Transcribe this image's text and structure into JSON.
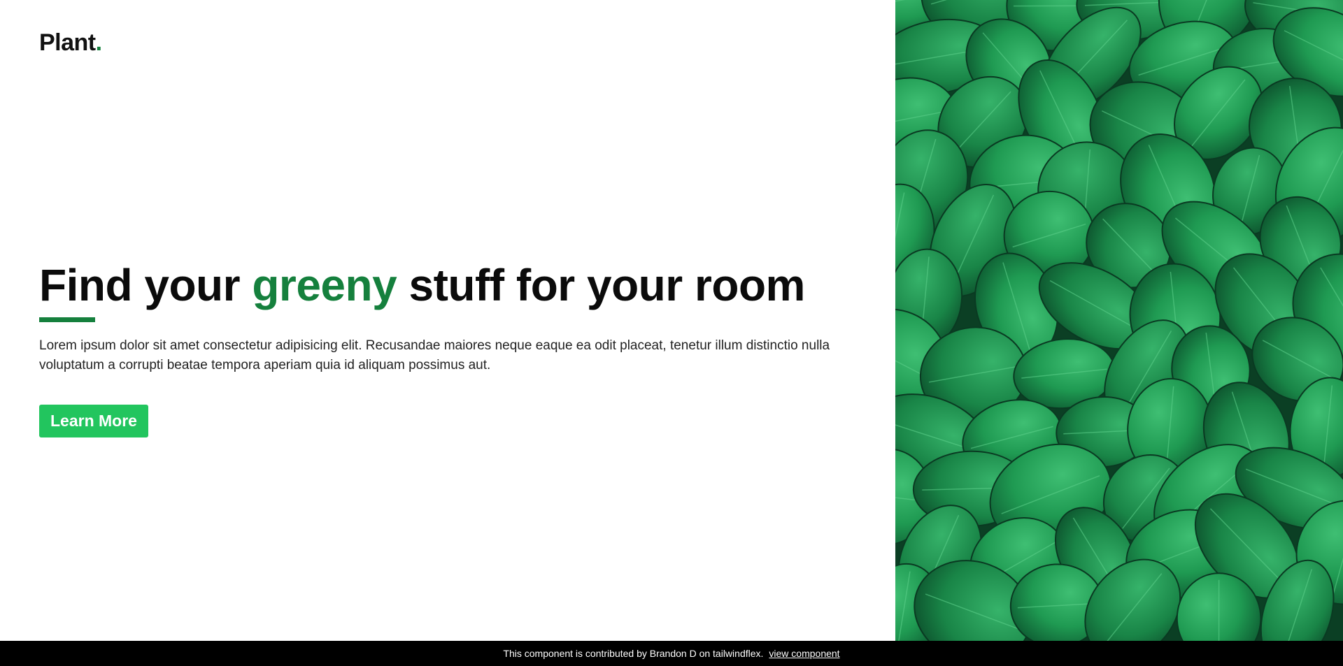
{
  "brand": {
    "name": "Plant",
    "dot": "."
  },
  "hero": {
    "headline_before": "Find your ",
    "headline_accent": "greeny",
    "headline_after": " stuff for your room",
    "description": "Lorem ipsum dolor sit amet consectetur adipisicing elit. Recusandae maiores neque eaque ea odit placeat, tenetur illum distinctio nulla voluptatum a corrupti beatae tempora aperiam quia id aliquam possimus aut.",
    "cta_label": "Learn More"
  },
  "image": {
    "subject": "green-leaves-photo"
  },
  "footer": {
    "text": "This component is contributed by Brandon D on tailwindflex.",
    "link_label": "view component"
  },
  "colors": {
    "accent": "#15803d",
    "button": "#22c55e",
    "footer_bg": "#000000"
  }
}
